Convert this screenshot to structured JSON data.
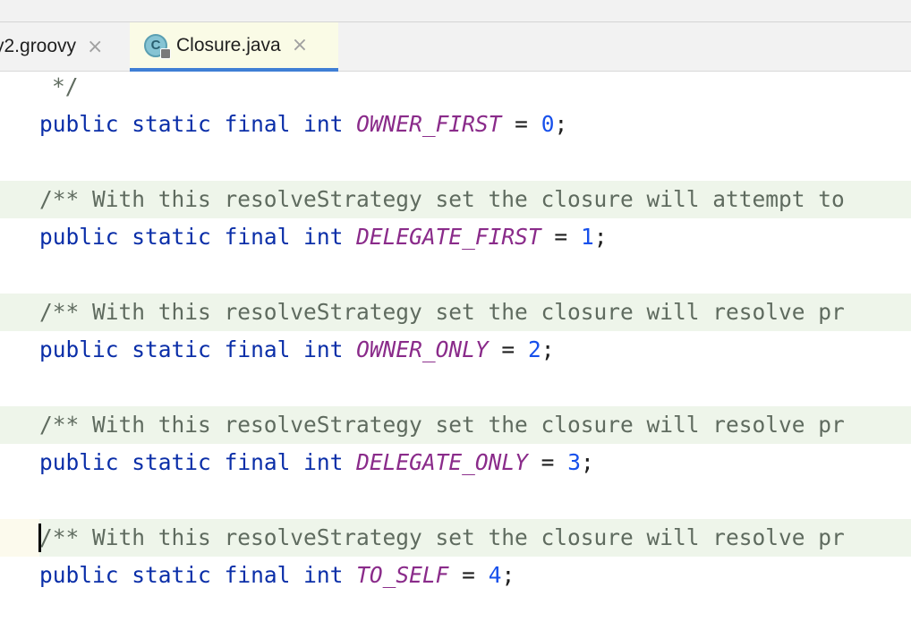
{
  "tabs": [
    {
      "label": "y2.groovy",
      "close": "×"
    },
    {
      "label": "Closure.java",
      "close": "×",
      "icon": "java-class-icon",
      "icon_letter": "C"
    }
  ],
  "code": {
    "comment_end": "*/",
    "kw_public": "public",
    "kw_static": "static",
    "kw_final": "final",
    "kw_int": "int",
    "eq": "=",
    "semi": ";",
    "decls": [
      {
        "name": "OWNER_FIRST",
        "value": "0"
      },
      {
        "name": "DELEGATE_FIRST",
        "value": "1"
      },
      {
        "name": "OWNER_ONLY",
        "value": "2"
      },
      {
        "name": "DELEGATE_ONLY",
        "value": "3"
      },
      {
        "name": "TO_SELF",
        "value": "4"
      }
    ],
    "doc_comments": [
      "/** With this resolveStrategy set the closure will attempt to",
      "/** With this resolveStrategy set the closure will resolve pr",
      "/** With this resolveStrategy set the closure will resolve pr",
      "/** With this resolveStrategy set the closure will resolve pr"
    ]
  }
}
